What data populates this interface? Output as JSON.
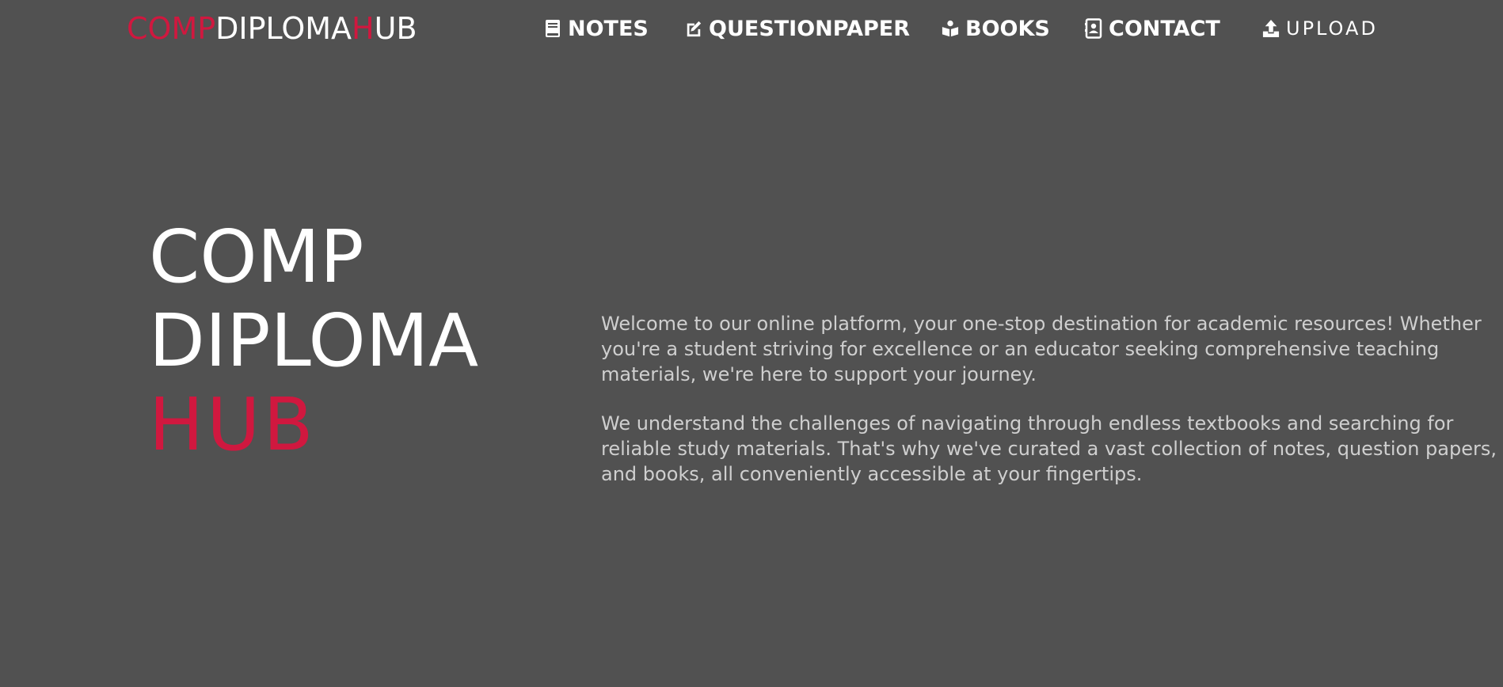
{
  "brand": {
    "part1": "COMP",
    "part2": "DIPLOMA",
    "part3": "H",
    "part4": "UB"
  },
  "nav": {
    "items": [
      {
        "label": "NOTES",
        "icon": "book-icon"
      },
      {
        "label": "QUESTIONPAPER",
        "icon": "edit-icon"
      },
      {
        "label": "BOOKS",
        "icon": "book-reader-icon"
      },
      {
        "label": "CONTACT",
        "icon": "address-book-icon"
      },
      {
        "label": "UPLOAD",
        "icon": "upload-icon"
      }
    ]
  },
  "hero": {
    "title_line1": "COMP",
    "title_line2": "DIPLOMA",
    "title_line3": "HUB",
    "paragraph1": "Welcome to our online platform, your one-stop destination for academic resources! Whether you're a student striving for excellence or an educator seeking comprehensive teaching materials, we're here to support your journey.",
    "paragraph2": "We understand the challenges of navigating through endless textbooks and searching for reliable study materials. That's why we've curated a vast collection of notes, question papers, and books, all conveniently accessible at your fingertips."
  },
  "colors": {
    "background": "#515151",
    "accent": "#d0183f",
    "text": "#ffffff",
    "body_text": "#cfcfcf"
  }
}
